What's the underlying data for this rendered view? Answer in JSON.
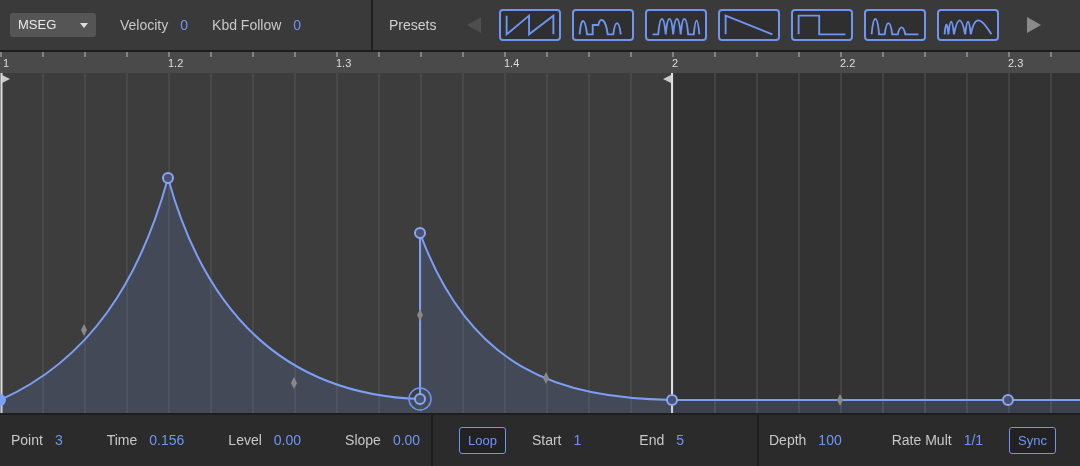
{
  "toolbar": {
    "mode": "MSEG",
    "velocity": {
      "label": "Velocity",
      "value": "0"
    },
    "kbd_follow": {
      "label": "Kbd Follow",
      "value": "0"
    }
  },
  "presets": {
    "label": "Presets",
    "prev_disabled": true,
    "next_disabled": false
  },
  "ruler": {
    "labels": [
      "1",
      "1.2",
      "1.3",
      "1.4",
      "2",
      "2.2",
      "2.3"
    ]
  },
  "footer": {
    "fields": [
      {
        "label": "Point",
        "value": "3"
      },
      {
        "label": "Time",
        "value": "0.156"
      },
      {
        "label": "Level",
        "value": "0.00"
      },
      {
        "label": "Slope",
        "value": "0.00"
      }
    ],
    "loop": {
      "label": "Loop",
      "on": true
    },
    "loop_fields": [
      {
        "label": "Start",
        "value": "1"
      },
      {
        "label": "End",
        "value": "5"
      }
    ],
    "mod_fields": [
      {
        "label": "Depth",
        "value": "100"
      },
      {
        "label": "Rate Mult",
        "value": "1/1"
      }
    ],
    "sync": {
      "label": "Sync",
      "on": true
    }
  }
}
